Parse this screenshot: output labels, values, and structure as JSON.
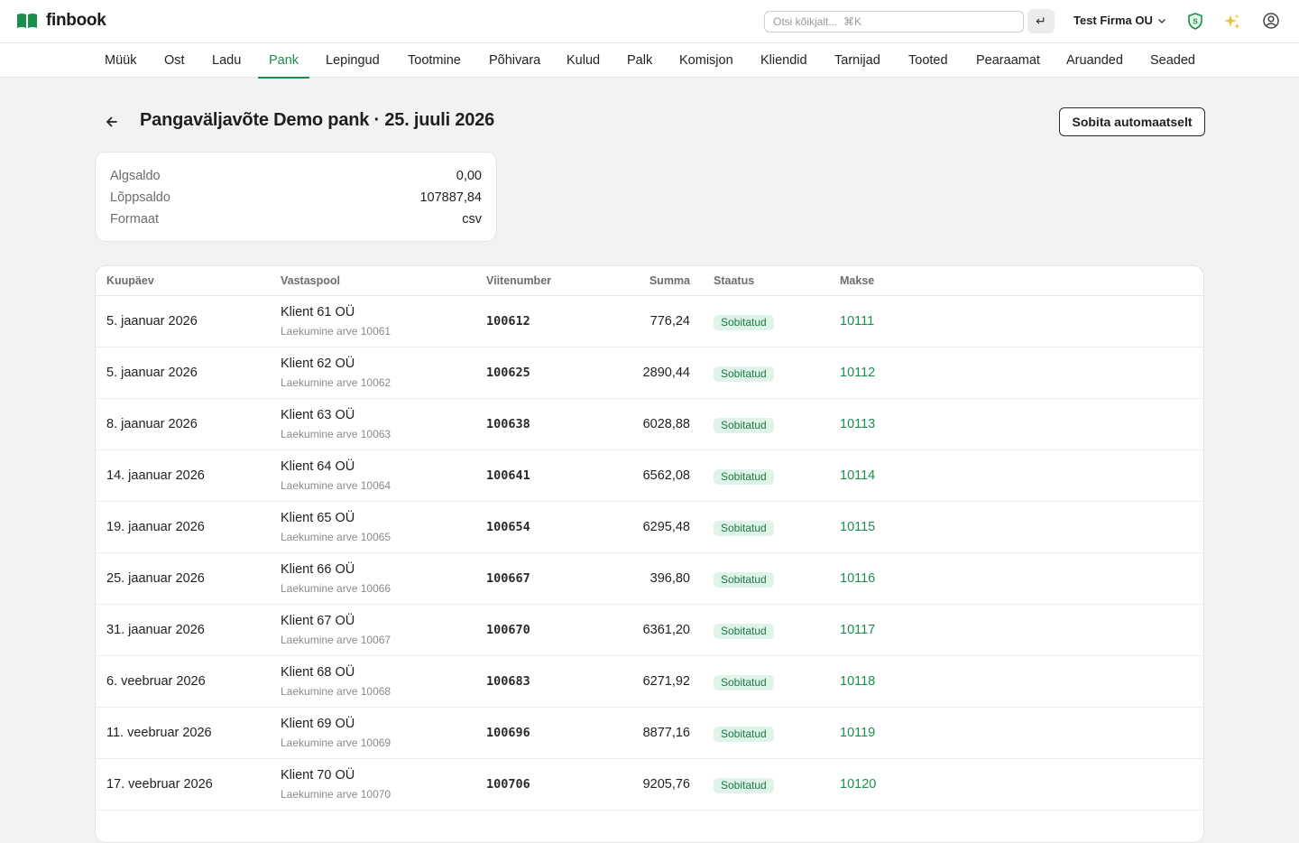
{
  "app": {
    "name": "finbook"
  },
  "header": {
    "search_placeholder": "Otsi kõikjalt...  ⌘K",
    "enter_symbol": "↵",
    "company": "Test Firma OU"
  },
  "nav": {
    "items": [
      "Müük",
      "Ost",
      "Ladu",
      "Pank",
      "Lepingud",
      "Tootmine",
      "Põhivara",
      "Kulud",
      "Palk",
      "Komisjon",
      "Kliendid",
      "Tarnijad",
      "Tooted",
      "Pearaamat",
      "Aruanded",
      "Seaded"
    ],
    "active": "Pank"
  },
  "page": {
    "title": "Pangaväljavõte Demo pank · 25. juuli 2026",
    "auto_match_label": "Sobita automaatselt"
  },
  "summary": {
    "rows": [
      {
        "label": "Algsaldo",
        "value": "0,00"
      },
      {
        "label": "Lõppsaldo",
        "value": "107887,84"
      },
      {
        "label": "Formaat",
        "value": "csv"
      }
    ]
  },
  "table": {
    "headers": {
      "date": "Kuupäev",
      "party": "Vastaspool",
      "ref": "Viitenumber",
      "sum": "Summa",
      "status": "Staatus",
      "payment": "Makse"
    },
    "rows": [
      {
        "date": "5. jaanuar 2026",
        "party": "Klient 61 OÜ",
        "desc": "Laekumine arve 10061",
        "ref": "100612",
        "sum": "776,24",
        "status": "Sobitatud",
        "payment": "10111"
      },
      {
        "date": "5. jaanuar 2026",
        "party": "Klient 62 OÜ",
        "desc": "Laekumine arve 10062",
        "ref": "100625",
        "sum": "2890,44",
        "status": "Sobitatud",
        "payment": "10112"
      },
      {
        "date": "8. jaanuar 2026",
        "party": "Klient 63 OÜ",
        "desc": "Laekumine arve 10063",
        "ref": "100638",
        "sum": "6028,88",
        "status": "Sobitatud",
        "payment": "10113"
      },
      {
        "date": "14. jaanuar 2026",
        "party": "Klient 64 OÜ",
        "desc": "Laekumine arve 10064",
        "ref": "100641",
        "sum": "6562,08",
        "status": "Sobitatud",
        "payment": "10114"
      },
      {
        "date": "19. jaanuar 2026",
        "party": "Klient 65 OÜ",
        "desc": "Laekumine arve 10065",
        "ref": "100654",
        "sum": "6295,48",
        "status": "Sobitatud",
        "payment": "10115"
      },
      {
        "date": "25. jaanuar 2026",
        "party": "Klient 66 OÜ",
        "desc": "Laekumine arve 10066",
        "ref": "100667",
        "sum": "396,80",
        "status": "Sobitatud",
        "payment": "10116"
      },
      {
        "date": "31. jaanuar 2026",
        "party": "Klient 67 OÜ",
        "desc": "Laekumine arve 10067",
        "ref": "100670",
        "sum": "6361,20",
        "status": "Sobitatud",
        "payment": "10117"
      },
      {
        "date": "6. veebruar 2026",
        "party": "Klient 68 OÜ",
        "desc": "Laekumine arve 10068",
        "ref": "100683",
        "sum": "6271,92",
        "status": "Sobitatud",
        "payment": "10118"
      },
      {
        "date": "11. veebruar 2026",
        "party": "Klient 69 OÜ",
        "desc": "Laekumine arve 10069",
        "ref": "100696",
        "sum": "8877,16",
        "status": "Sobitatud",
        "payment": "10119"
      },
      {
        "date": "17. veebruar 2026",
        "party": "Klient 70 OÜ",
        "desc": "Laekumine arve 10070",
        "ref": "100706",
        "sum": "9205,76",
        "status": "Sobitatud",
        "payment": "10120"
      }
    ]
  },
  "colors": {
    "accent": "#1a8f4c",
    "status_bg": "#e0f3e8",
    "status_text": "#1c7a45",
    "page_bg": "#f2f2f2"
  },
  "icons": [
    "book-logo-icon",
    "enter-icon",
    "chevron-down-icon",
    "shield-icon",
    "sparkle-icon",
    "user-icon",
    "back-arrow-icon"
  ]
}
